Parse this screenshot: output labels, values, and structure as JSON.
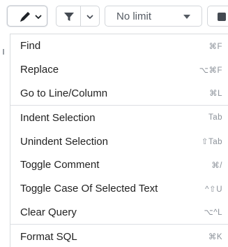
{
  "toolbar": {
    "edit_icon": "pencil-icon",
    "filter_icon": "funnel-icon",
    "limit_value": "No limit"
  },
  "menu": {
    "groups": [
      {
        "items": [
          {
            "label": "Find",
            "shortcut": "⌘F"
          },
          {
            "label": "Replace",
            "shortcut": "⌥⌘F"
          },
          {
            "label": "Go to Line/Column",
            "shortcut": "⌘L"
          }
        ]
      },
      {
        "items": [
          {
            "label": "Indent Selection",
            "shortcut": "Tab"
          },
          {
            "label": "Unindent Selection",
            "shortcut": "⇧Tab"
          },
          {
            "label": "Toggle Comment",
            "shortcut": "⌘/"
          },
          {
            "label": "Toggle Case Of Selected Text",
            "shortcut": "^⇧U"
          },
          {
            "label": "Clear Query",
            "shortcut": "⌥^L"
          }
        ]
      },
      {
        "items": [
          {
            "label": "Format SQL",
            "shortcut": "⌘K"
          }
        ]
      }
    ]
  },
  "colors": {
    "text": "#222222",
    "shortcut": "#8b9199",
    "border": "#d3d6da"
  }
}
